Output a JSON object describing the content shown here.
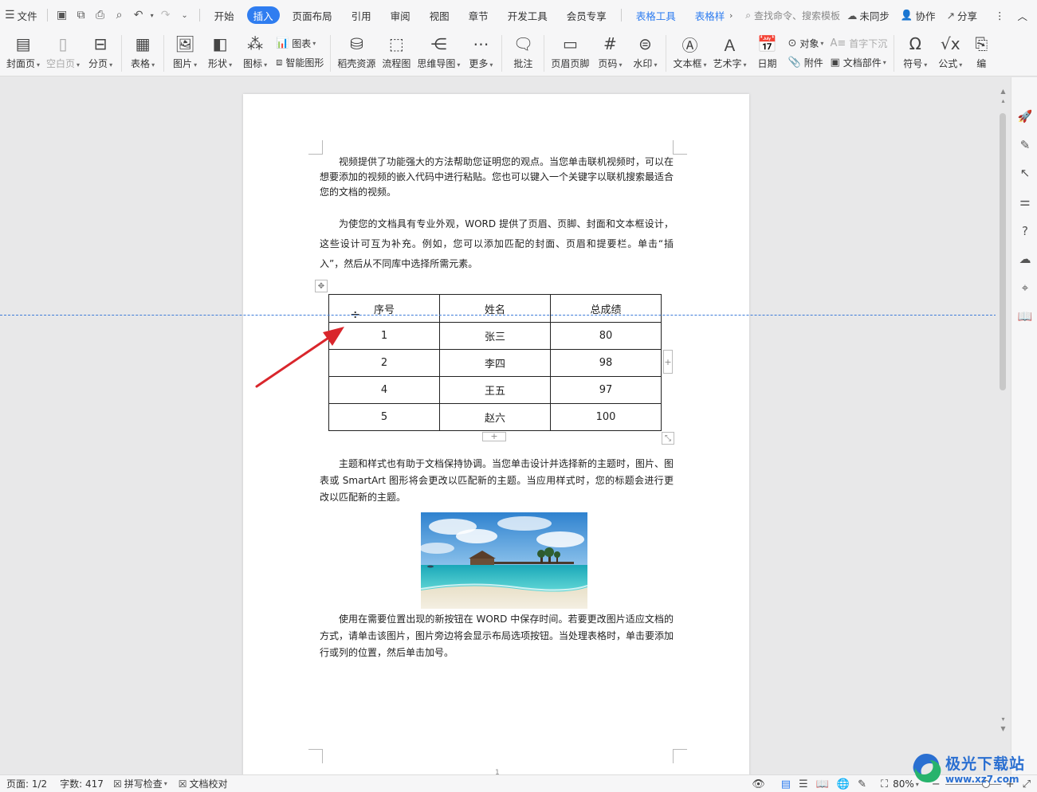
{
  "menubar": {
    "file_label": "文件",
    "tabs": [
      {
        "label": "开始",
        "active": false
      },
      {
        "label": "插入",
        "active": true
      },
      {
        "label": "页面布局",
        "active": false
      },
      {
        "label": "引用",
        "active": false
      },
      {
        "label": "审阅",
        "active": false
      },
      {
        "label": "视图",
        "active": false
      },
      {
        "label": "章节",
        "active": false
      },
      {
        "label": "开发工具",
        "active": false
      },
      {
        "label": "会员专享",
        "active": false
      }
    ],
    "tool_tabs": [
      "表格工具",
      "表格样"
    ],
    "search_placeholder": "查找命令、搜索模板",
    "sync_label": "未同步",
    "collab_label": "协作",
    "share_label": "分享"
  },
  "ribbon": {
    "cover_page": "封面页",
    "blank_page": "空白页",
    "page_break": "分页",
    "table": "表格",
    "picture": "图片",
    "shape": "形状",
    "icon": "图标",
    "chart": "图表",
    "smart_shape": "智能图形",
    "daoke_resources": "稻壳资源",
    "flowchart": "流程图",
    "mindmap": "思维导图",
    "more": "更多",
    "comment": "批注",
    "header_footer": "页眉页脚",
    "page_number": "页码",
    "watermark": "水印",
    "textbox": "文本框",
    "wordart": "艺术字",
    "date": "日期",
    "object": "对象",
    "attachment": "附件",
    "drop_cap": "首字下沉",
    "doc_parts": "文档部件",
    "symbol": "符号",
    "formula": "公式",
    "edit_truncated": "编"
  },
  "document": {
    "paragraphs": [
      "视频提供了功能强大的方法帮助您证明您的观点。当您单击联机视频时，可以在想要添加的视频的嵌入代码中进行粘贴。您也可以键入一个关键字以联机搜索最适合您的文档的视频。",
      "为使您的文档具有专业外观，WORD 提供了页眉、页脚、封面和文本框设计，这些设计可互为补充。例如，您可以添加匹配的封面、页眉和提要栏。单击“插入”，然后从不同库中选择所需元素。",
      "主题和样式也有助于文档保持协调。当您单击设计并选择新的主题时，图片、图表或 SmartArt 图形将会更改以匹配新的主题。当应用样式时，您的标题会进行更改以匹配新的主题。",
      "使用在需要位置出现的新按钮在 WORD 中保存时间。若要更改图片适应文档的方式，请单击该图片，图片旁边将会显示布局选项按钮。当处理表格时，单击要添加行或列的位置，然后单击加号。"
    ],
    "table": {
      "headers": [
        "序号",
        "姓名",
        "总成绩"
      ],
      "rows": [
        [
          "1",
          "张三",
          "80"
        ],
        [
          "2",
          "李四",
          "98"
        ],
        [
          "4",
          "王五",
          "97"
        ],
        [
          "5",
          "赵六",
          "100"
        ]
      ]
    },
    "page_marker": "1"
  },
  "statusbar": {
    "page": "页面: 1/2",
    "word_count": "字数: 417",
    "spell_check": "拼写检查",
    "doc_proofread": "文档校对",
    "zoom": "80%",
    "zoom_level": 0.8
  },
  "watermark_logo": {
    "title": "极光下载站",
    "url": "www.xz7.com"
  },
  "colors": {
    "accent": "#2f7df0",
    "arrow": "#d9262c",
    "guide": "#3c7bd8"
  }
}
